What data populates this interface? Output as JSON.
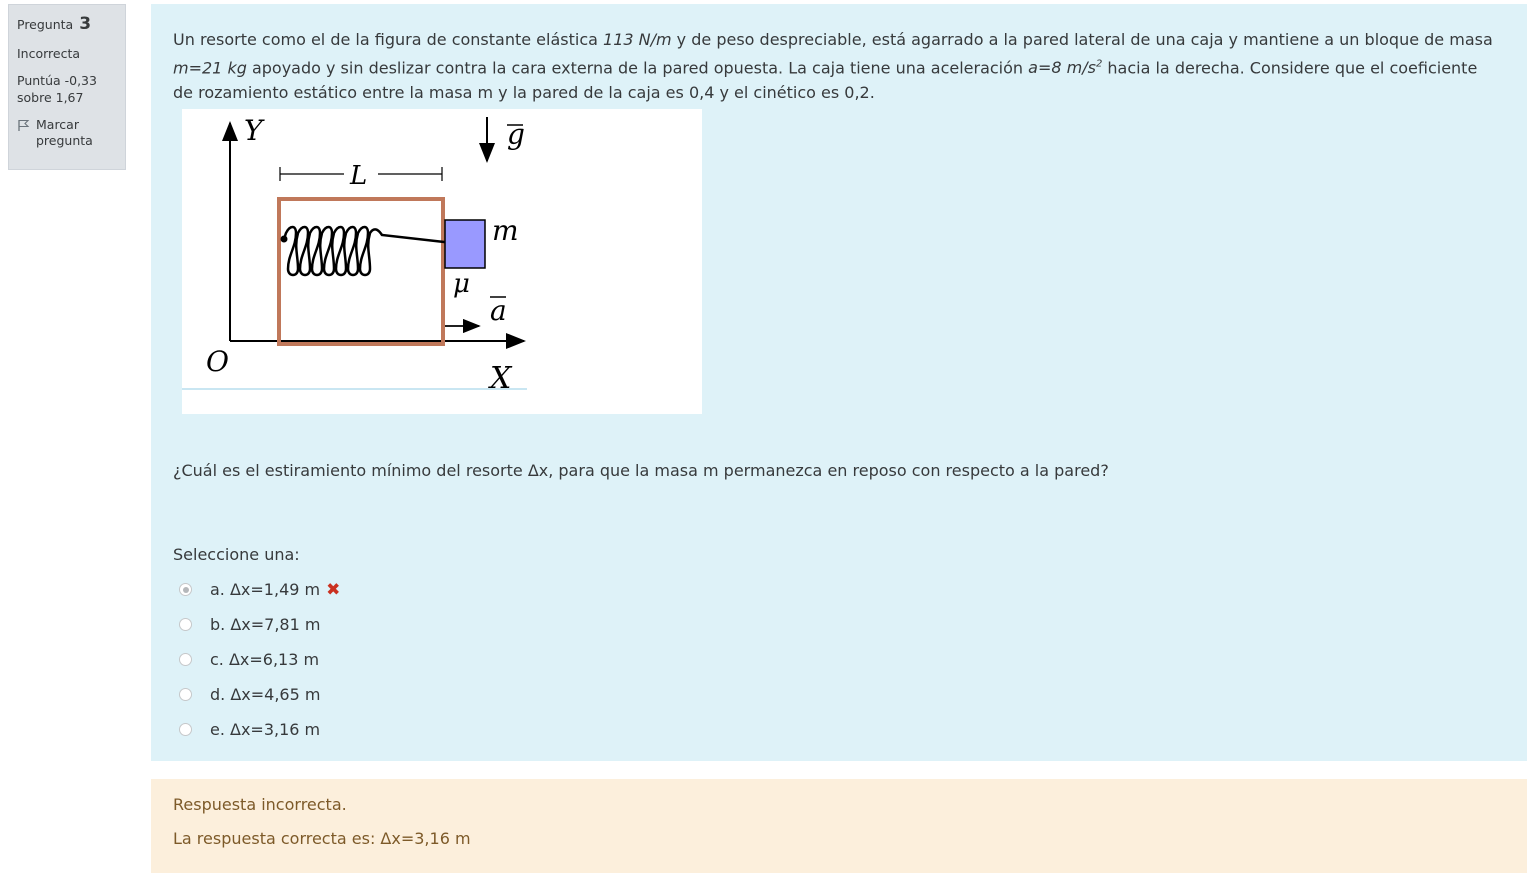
{
  "info": {
    "question_label": "Pregunta",
    "question_number": "3",
    "state": "Incorrecta",
    "grade": "Puntúa -0,33 sobre 1,67",
    "flag_label": "Marcar pregunta"
  },
  "question": {
    "text_1": "Un resorte como el de la figura de constante elástica ",
    "k_value": "113 N/m",
    "text_2": " y de peso despreciable, está agarrado a la pared lateral de una caja y mantiene a un bloque de masa ",
    "m_value": "m=21 kg",
    "text_3": " apoyado y sin deslizar contra la cara externa de la pared opuesta. La caja tiene una aceleración ",
    "a_value": "a=8 m/s",
    "a_exp": "2",
    "text_4": " hacia la derecha. Considere que el coeficiente de rozamiento estático entre la masa m y la pared de la caja es 0,4 y el cinético es 0,2.",
    "ask": "¿Cuál es el estiramiento mínimo del resorte Δx, para que la masa m permanezca en reposo con respecto a la pared?",
    "prompt": "Seleccione una:"
  },
  "figure": {
    "y_axis": "Y",
    "x_axis": "X",
    "origin": "O",
    "length": "L",
    "gravity": "g",
    "accel": "a",
    "mass": "m",
    "mu": "μ"
  },
  "options": [
    {
      "label": "a. Δx=1,49 m",
      "selected": true,
      "wrong": true
    },
    {
      "label": "b. Δx=7,81 m",
      "selected": false
    },
    {
      "label": "c. Δx=6,13 m",
      "selected": false
    },
    {
      "label": "d. Δx=4,65 m",
      "selected": false
    },
    {
      "label": "e. Δx=3,16 m",
      "selected": false
    }
  ],
  "wrong_mark": "✖",
  "feedback": {
    "general": "Respuesta incorrecta.",
    "right_answer": "La respuesta correcta es: Δx=3,16 m"
  },
  "colors": {
    "formulation_bg": "#def2f8",
    "outcome_bg": "#fcefdc",
    "info_bg": "#dee2e6",
    "box_stroke": "#c0785a",
    "block_fill": "#9999ff",
    "wrong": "#ca3120"
  }
}
